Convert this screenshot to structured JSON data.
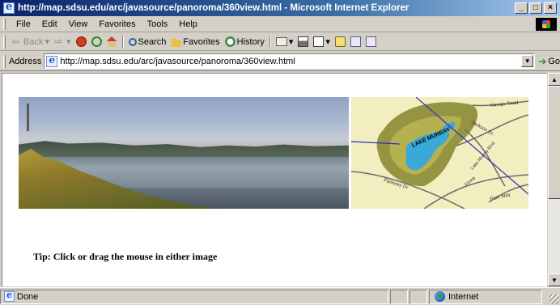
{
  "window": {
    "title": "http://map.sdsu.edu/arc/javasource/panoroma/360view.html - Microsoft Internet Explorer",
    "minimize": "_",
    "maximize": "□",
    "close": "×"
  },
  "menu": {
    "items": [
      "File",
      "Edit",
      "View",
      "Favorites",
      "Tools",
      "Help"
    ]
  },
  "toolbar": {
    "back": "Back",
    "search": "Search",
    "favorites": "Favorites",
    "history": "History"
  },
  "address": {
    "label": "Address",
    "url": "http://map.sdsu.edu/arc/javasource/panoroma/360view.html",
    "go": "Go"
  },
  "content": {
    "map_label": "LAKE MURRAY",
    "roads": [
      "Navajo Road",
      "Jackson Dr.",
      "Lake Murray Blvd.",
      "Kiowa",
      "Park Way",
      "Parkway Dr."
    ],
    "tip": "Tip: Click or drag the mouse in either image"
  },
  "status": {
    "text": "Done",
    "zone": "Internet"
  },
  "colors": {
    "titlebar": "#0a246a",
    "chrome": "#d4d0c8",
    "lake": "#3aa8d8",
    "map_bg": "#f2eec0"
  }
}
